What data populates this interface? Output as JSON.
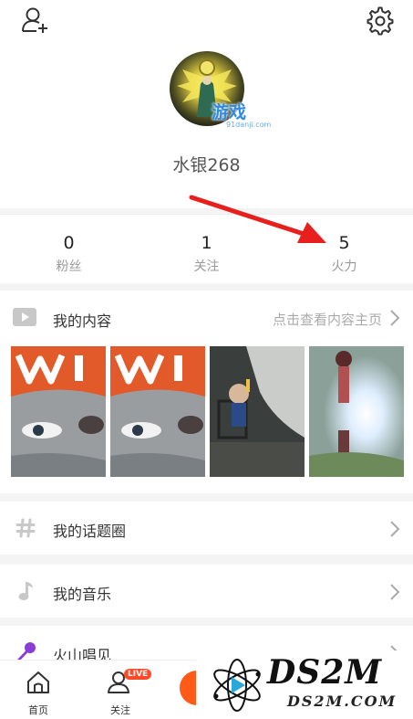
{
  "profile": {
    "username": "水银268",
    "avatar_watermark": "游戏",
    "avatar_watermark_sub": "91danji.com"
  },
  "stats": [
    {
      "value": "0",
      "label": "粉丝"
    },
    {
      "value": "1",
      "label": "关注"
    },
    {
      "value": "5",
      "label": "火力"
    }
  ],
  "content": {
    "title": "我的内容",
    "link": "点击查看内容主页"
  },
  "menu": [
    {
      "label": "我的话题圈",
      "icon": "hashtag-icon"
    },
    {
      "label": "我的音乐",
      "icon": "music-note-icon"
    },
    {
      "label": "火山唱见",
      "icon": "microphone-icon"
    }
  ],
  "tabbar": {
    "home": "首页",
    "follow": "关注",
    "live_badge": "LIVE"
  },
  "watermark": {
    "text": "DS2M",
    "sub": "DS2M.COM"
  },
  "colors": {
    "accent": "#ff5a16",
    "annotation_arrow": "#e8201d",
    "link": "#aaaaaa"
  }
}
